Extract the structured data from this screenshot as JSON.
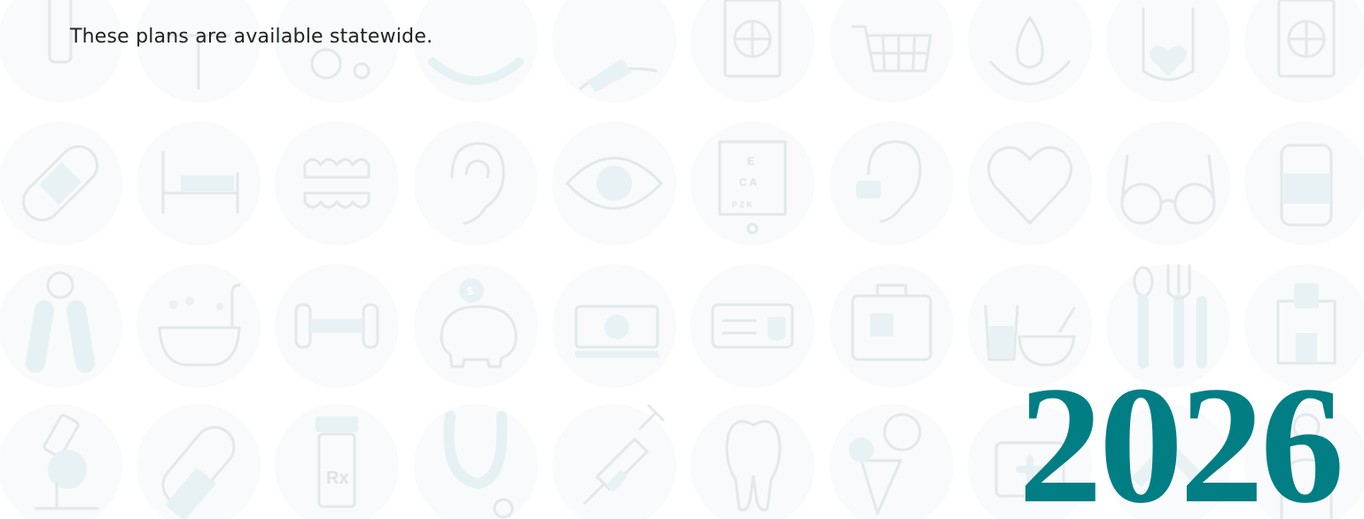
{
  "caption": "These plans are available statewide.",
  "year": "2026",
  "colors": {
    "year": "#007e84",
    "caption": "#222222",
    "icon_outline": "#e3e8ea",
    "icon_tint": "#e8f2f4",
    "bubble": "#f8fafb"
  },
  "background_icons": [
    [
      "tube-icon",
      "cane-icon",
      "stethoscope-icon",
      "scale-icon",
      "helping-hand-icon",
      "passport-icon",
      "shopping-cart-icon",
      "water-drop-icon",
      "heart-hand-icon",
      "passport-icon"
    ],
    [
      "bandage-icon",
      "hospital-bed-icon",
      "dentures-icon",
      "ear-icon",
      "eye-icon",
      "eye-chart-icon",
      "hearing-aid-icon",
      "heart-icon",
      "eyeglasses-icon",
      "supplement-jar-icon"
    ],
    [
      "hand-grip-icon",
      "bathtub-icon",
      "dumbbell-icon",
      "piggy-bank-icon",
      "zero-dollar-bill-icon",
      "id-card-icon",
      "first-aid-kit-icon",
      "meal-icon",
      "utensils-icon",
      "hospital-icon"
    ],
    [
      "microscope-icon",
      "pill-icon",
      "rx-bottle-icon",
      "stethoscope-icon",
      "syringe-icon",
      "tooth-icon",
      "healthy-food-icon",
      "first-aid-icon",
      "scale-icon",
      "doctor-icon"
    ]
  ]
}
